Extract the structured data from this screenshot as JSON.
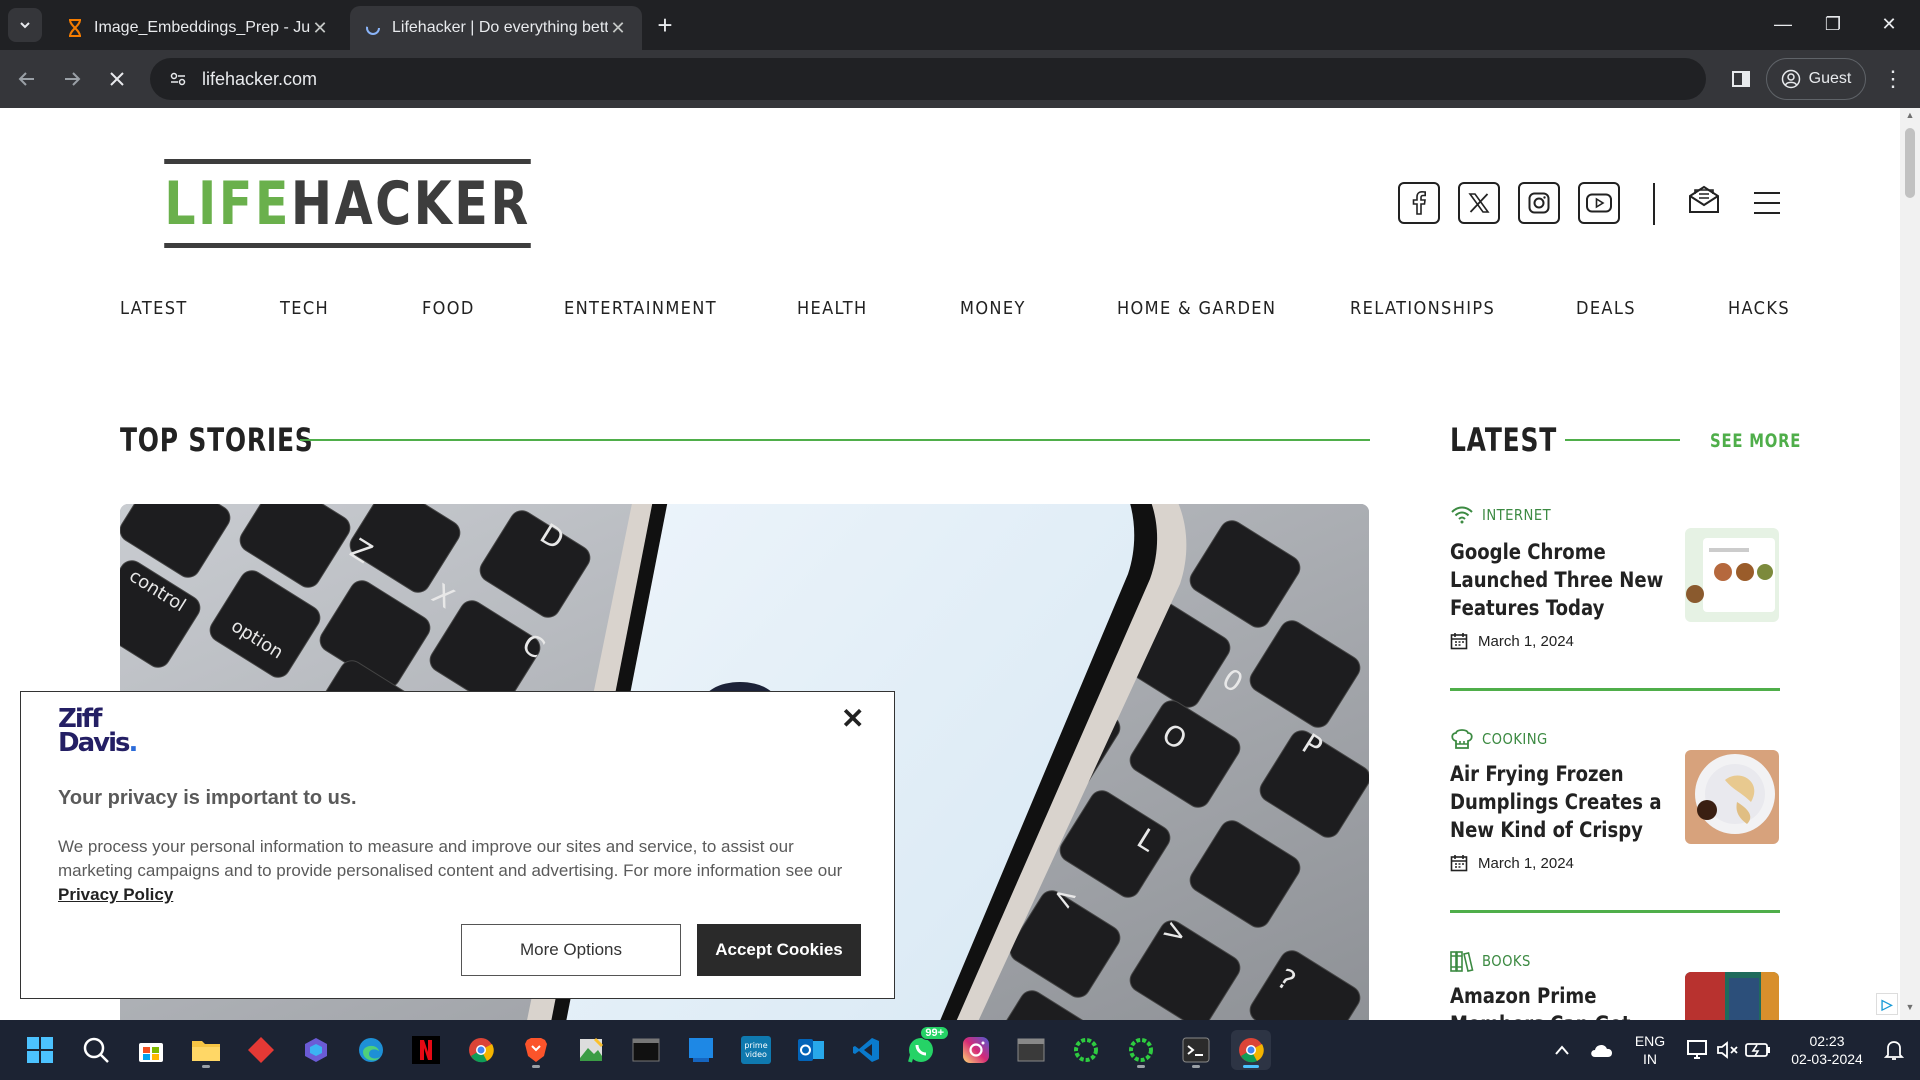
{
  "browser": {
    "tabs": [
      {
        "title": "Image_Embeddings_Prep - Jupyter",
        "active": false
      },
      {
        "title": "Lifehacker | Do everything better",
        "active": true
      }
    ],
    "address": "lifehacker.com",
    "profile_label": "Guest"
  },
  "site": {
    "logo_part1": "LIFE",
    "logo_part2": "HACKER",
    "nav": [
      "LATEST",
      "TECH",
      "FOOD",
      "ENTERTAINMENT",
      "HEALTH",
      "MONEY",
      "HOME & GARDEN",
      "RELATIONSHIPS",
      "DEALS",
      "HACKS"
    ],
    "top_stories_title": "TOP STORIES",
    "latest_title": "LATEST",
    "see_more": "SEE MORE",
    "latest": [
      {
        "category": "INTERNET",
        "title": "Google Chrome Launched Three New Features Today",
        "date": "March 1, 2024"
      },
      {
        "category": "COOKING",
        "title": "Air Frying Frozen Dumplings Creates a New Kind of Crispy",
        "date": "March 1, 2024"
      },
      {
        "category": "BOOKS",
        "title": "Amazon Prime Members Can Get Two",
        "date": ""
      }
    ]
  },
  "cookie": {
    "brand_line1": "Ziff",
    "brand_line2": "Davis",
    "heading": "Your privacy is important to us.",
    "body": "We process your personal information to measure and improve our sites and service, to assist our marketing campaigns and to provide personalised content and advertising. For more information see our",
    "link": "Privacy Policy",
    "more_options": "More Options",
    "accept": "Accept Cookies"
  },
  "taskbar": {
    "whatsapp_badge": "99+",
    "lang_line1": "ENG",
    "lang_line2": "IN",
    "time": "02:23",
    "date": "02-03-2024"
  },
  "colors": {
    "brand_green": "#4fae4a",
    "logo_green": "#6ab04c",
    "dark": "#222222"
  }
}
